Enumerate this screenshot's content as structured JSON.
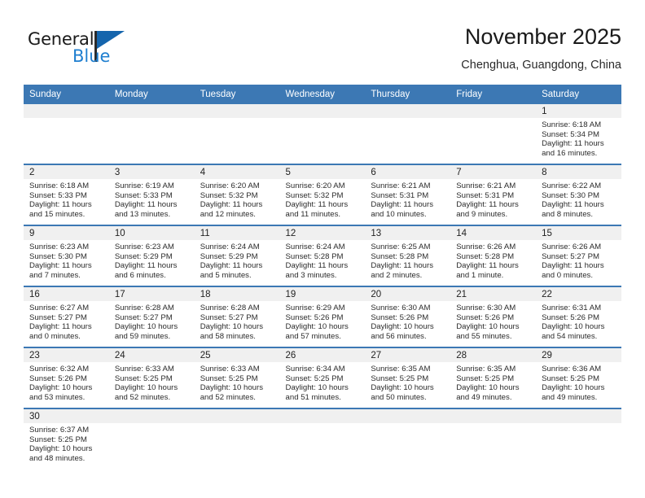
{
  "brand": {
    "name_top": "General",
    "name_bottom": "Blue",
    "flag_color": "#1565ad",
    "blue_color": "#1f7fd0"
  },
  "header": {
    "title": "November 2025",
    "subtitle": "Chenghua, Guangdong, China"
  },
  "theme": {
    "header_row_bg": "#3c78b4",
    "daynum_bg": "#f0f0f0",
    "separator": "#3c78b4"
  },
  "weekdays": [
    "Sunday",
    "Monday",
    "Tuesday",
    "Wednesday",
    "Thursday",
    "Friday",
    "Saturday"
  ],
  "labels": {
    "sunrise": "Sunrise:",
    "sunset": "Sunset:",
    "daylight": "Daylight:"
  },
  "weeks": [
    [
      {
        "day": "",
        "blank": true
      },
      {
        "day": "",
        "blank": true
      },
      {
        "day": "",
        "blank": true
      },
      {
        "day": "",
        "blank": true
      },
      {
        "day": "",
        "blank": true
      },
      {
        "day": "",
        "blank": true
      },
      {
        "day": "1",
        "sunrise": "Sunrise: 6:18 AM",
        "sunset": "Sunset: 5:34 PM",
        "daylight1": "Daylight: 11 hours",
        "daylight2": "and 16 minutes."
      }
    ],
    [
      {
        "day": "2",
        "sunrise": "Sunrise: 6:18 AM",
        "sunset": "Sunset: 5:33 PM",
        "daylight1": "Daylight: 11 hours",
        "daylight2": "and 15 minutes."
      },
      {
        "day": "3",
        "sunrise": "Sunrise: 6:19 AM",
        "sunset": "Sunset: 5:33 PM",
        "daylight1": "Daylight: 11 hours",
        "daylight2": "and 13 minutes."
      },
      {
        "day": "4",
        "sunrise": "Sunrise: 6:20 AM",
        "sunset": "Sunset: 5:32 PM",
        "daylight1": "Daylight: 11 hours",
        "daylight2": "and 12 minutes."
      },
      {
        "day": "5",
        "sunrise": "Sunrise: 6:20 AM",
        "sunset": "Sunset: 5:32 PM",
        "daylight1": "Daylight: 11 hours",
        "daylight2": "and 11 minutes."
      },
      {
        "day": "6",
        "sunrise": "Sunrise: 6:21 AM",
        "sunset": "Sunset: 5:31 PM",
        "daylight1": "Daylight: 11 hours",
        "daylight2": "and 10 minutes."
      },
      {
        "day": "7",
        "sunrise": "Sunrise: 6:21 AM",
        "sunset": "Sunset: 5:31 PM",
        "daylight1": "Daylight: 11 hours",
        "daylight2": "and 9 minutes."
      },
      {
        "day": "8",
        "sunrise": "Sunrise: 6:22 AM",
        "sunset": "Sunset: 5:30 PM",
        "daylight1": "Daylight: 11 hours",
        "daylight2": "and 8 minutes."
      }
    ],
    [
      {
        "day": "9",
        "sunrise": "Sunrise: 6:23 AM",
        "sunset": "Sunset: 5:30 PM",
        "daylight1": "Daylight: 11 hours",
        "daylight2": "and 7 minutes."
      },
      {
        "day": "10",
        "sunrise": "Sunrise: 6:23 AM",
        "sunset": "Sunset: 5:29 PM",
        "daylight1": "Daylight: 11 hours",
        "daylight2": "and 6 minutes."
      },
      {
        "day": "11",
        "sunrise": "Sunrise: 6:24 AM",
        "sunset": "Sunset: 5:29 PM",
        "daylight1": "Daylight: 11 hours",
        "daylight2": "and 5 minutes."
      },
      {
        "day": "12",
        "sunrise": "Sunrise: 6:24 AM",
        "sunset": "Sunset: 5:28 PM",
        "daylight1": "Daylight: 11 hours",
        "daylight2": "and 3 minutes."
      },
      {
        "day": "13",
        "sunrise": "Sunrise: 6:25 AM",
        "sunset": "Sunset: 5:28 PM",
        "daylight1": "Daylight: 11 hours",
        "daylight2": "and 2 minutes."
      },
      {
        "day": "14",
        "sunrise": "Sunrise: 6:26 AM",
        "sunset": "Sunset: 5:28 PM",
        "daylight1": "Daylight: 11 hours",
        "daylight2": "and 1 minute."
      },
      {
        "day": "15",
        "sunrise": "Sunrise: 6:26 AM",
        "sunset": "Sunset: 5:27 PM",
        "daylight1": "Daylight: 11 hours",
        "daylight2": "and 0 minutes."
      }
    ],
    [
      {
        "day": "16",
        "sunrise": "Sunrise: 6:27 AM",
        "sunset": "Sunset: 5:27 PM",
        "daylight1": "Daylight: 11 hours",
        "daylight2": "and 0 minutes."
      },
      {
        "day": "17",
        "sunrise": "Sunrise: 6:28 AM",
        "sunset": "Sunset: 5:27 PM",
        "daylight1": "Daylight: 10 hours",
        "daylight2": "and 59 minutes."
      },
      {
        "day": "18",
        "sunrise": "Sunrise: 6:28 AM",
        "sunset": "Sunset: 5:27 PM",
        "daylight1": "Daylight: 10 hours",
        "daylight2": "and 58 minutes."
      },
      {
        "day": "19",
        "sunrise": "Sunrise: 6:29 AM",
        "sunset": "Sunset: 5:26 PM",
        "daylight1": "Daylight: 10 hours",
        "daylight2": "and 57 minutes."
      },
      {
        "day": "20",
        "sunrise": "Sunrise: 6:30 AM",
        "sunset": "Sunset: 5:26 PM",
        "daylight1": "Daylight: 10 hours",
        "daylight2": "and 56 minutes."
      },
      {
        "day": "21",
        "sunrise": "Sunrise: 6:30 AM",
        "sunset": "Sunset: 5:26 PM",
        "daylight1": "Daylight: 10 hours",
        "daylight2": "and 55 minutes."
      },
      {
        "day": "22",
        "sunrise": "Sunrise: 6:31 AM",
        "sunset": "Sunset: 5:26 PM",
        "daylight1": "Daylight: 10 hours",
        "daylight2": "and 54 minutes."
      }
    ],
    [
      {
        "day": "23",
        "sunrise": "Sunrise: 6:32 AM",
        "sunset": "Sunset: 5:26 PM",
        "daylight1": "Daylight: 10 hours",
        "daylight2": "and 53 minutes."
      },
      {
        "day": "24",
        "sunrise": "Sunrise: 6:33 AM",
        "sunset": "Sunset: 5:25 PM",
        "daylight1": "Daylight: 10 hours",
        "daylight2": "and 52 minutes."
      },
      {
        "day": "25",
        "sunrise": "Sunrise: 6:33 AM",
        "sunset": "Sunset: 5:25 PM",
        "daylight1": "Daylight: 10 hours",
        "daylight2": "and 52 minutes."
      },
      {
        "day": "26",
        "sunrise": "Sunrise: 6:34 AM",
        "sunset": "Sunset: 5:25 PM",
        "daylight1": "Daylight: 10 hours",
        "daylight2": "and 51 minutes."
      },
      {
        "day": "27",
        "sunrise": "Sunrise: 6:35 AM",
        "sunset": "Sunset: 5:25 PM",
        "daylight1": "Daylight: 10 hours",
        "daylight2": "and 50 minutes."
      },
      {
        "day": "28",
        "sunrise": "Sunrise: 6:35 AM",
        "sunset": "Sunset: 5:25 PM",
        "daylight1": "Daylight: 10 hours",
        "daylight2": "and 49 minutes."
      },
      {
        "day": "29",
        "sunrise": "Sunrise: 6:36 AM",
        "sunset": "Sunset: 5:25 PM",
        "daylight1": "Daylight: 10 hours",
        "daylight2": "and 49 minutes."
      }
    ],
    [
      {
        "day": "30",
        "sunrise": "Sunrise: 6:37 AM",
        "sunset": "Sunset: 5:25 PM",
        "daylight1": "Daylight: 10 hours",
        "daylight2": "and 48 minutes."
      },
      {
        "day": "",
        "blank": true
      },
      {
        "day": "",
        "blank": true
      },
      {
        "day": "",
        "blank": true
      },
      {
        "day": "",
        "blank": true
      },
      {
        "day": "",
        "blank": true
      },
      {
        "day": "",
        "blank": true
      }
    ]
  ]
}
